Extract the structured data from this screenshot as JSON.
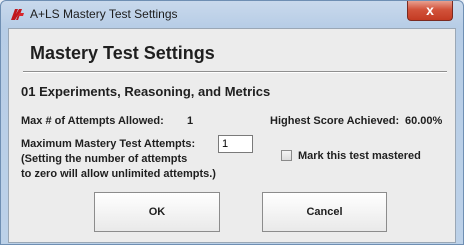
{
  "window": {
    "title": "A+LS Mastery Test Settings",
    "close_glyph": "x",
    "icon": "als-logo-icon"
  },
  "dialog": {
    "heading": "Mastery Test Settings",
    "section_title": "01 Experiments, Reasoning, and Metrics",
    "max_attempts_allowed_label": "Max # of Attempts Allowed:",
    "max_attempts_allowed_value": "1",
    "highest_score_label": "Highest Score Achieved:",
    "highest_score_value": "60.00%",
    "max_mastery_attempts_label": "Maximum Mastery Test Attempts:",
    "max_mastery_attempts_value": "1",
    "help_line1": "(Setting the number of attempts",
    "help_line2": "to zero will allow unlimited attempts.)",
    "mark_mastered_label": "Mark this test mastered",
    "mark_mastered_checked": false
  },
  "buttons": {
    "ok": "OK",
    "cancel": "Cancel"
  },
  "colors": {
    "titlebar": "#b7cde6",
    "client_bg": "#ececec",
    "close_button": "#c43b23"
  }
}
